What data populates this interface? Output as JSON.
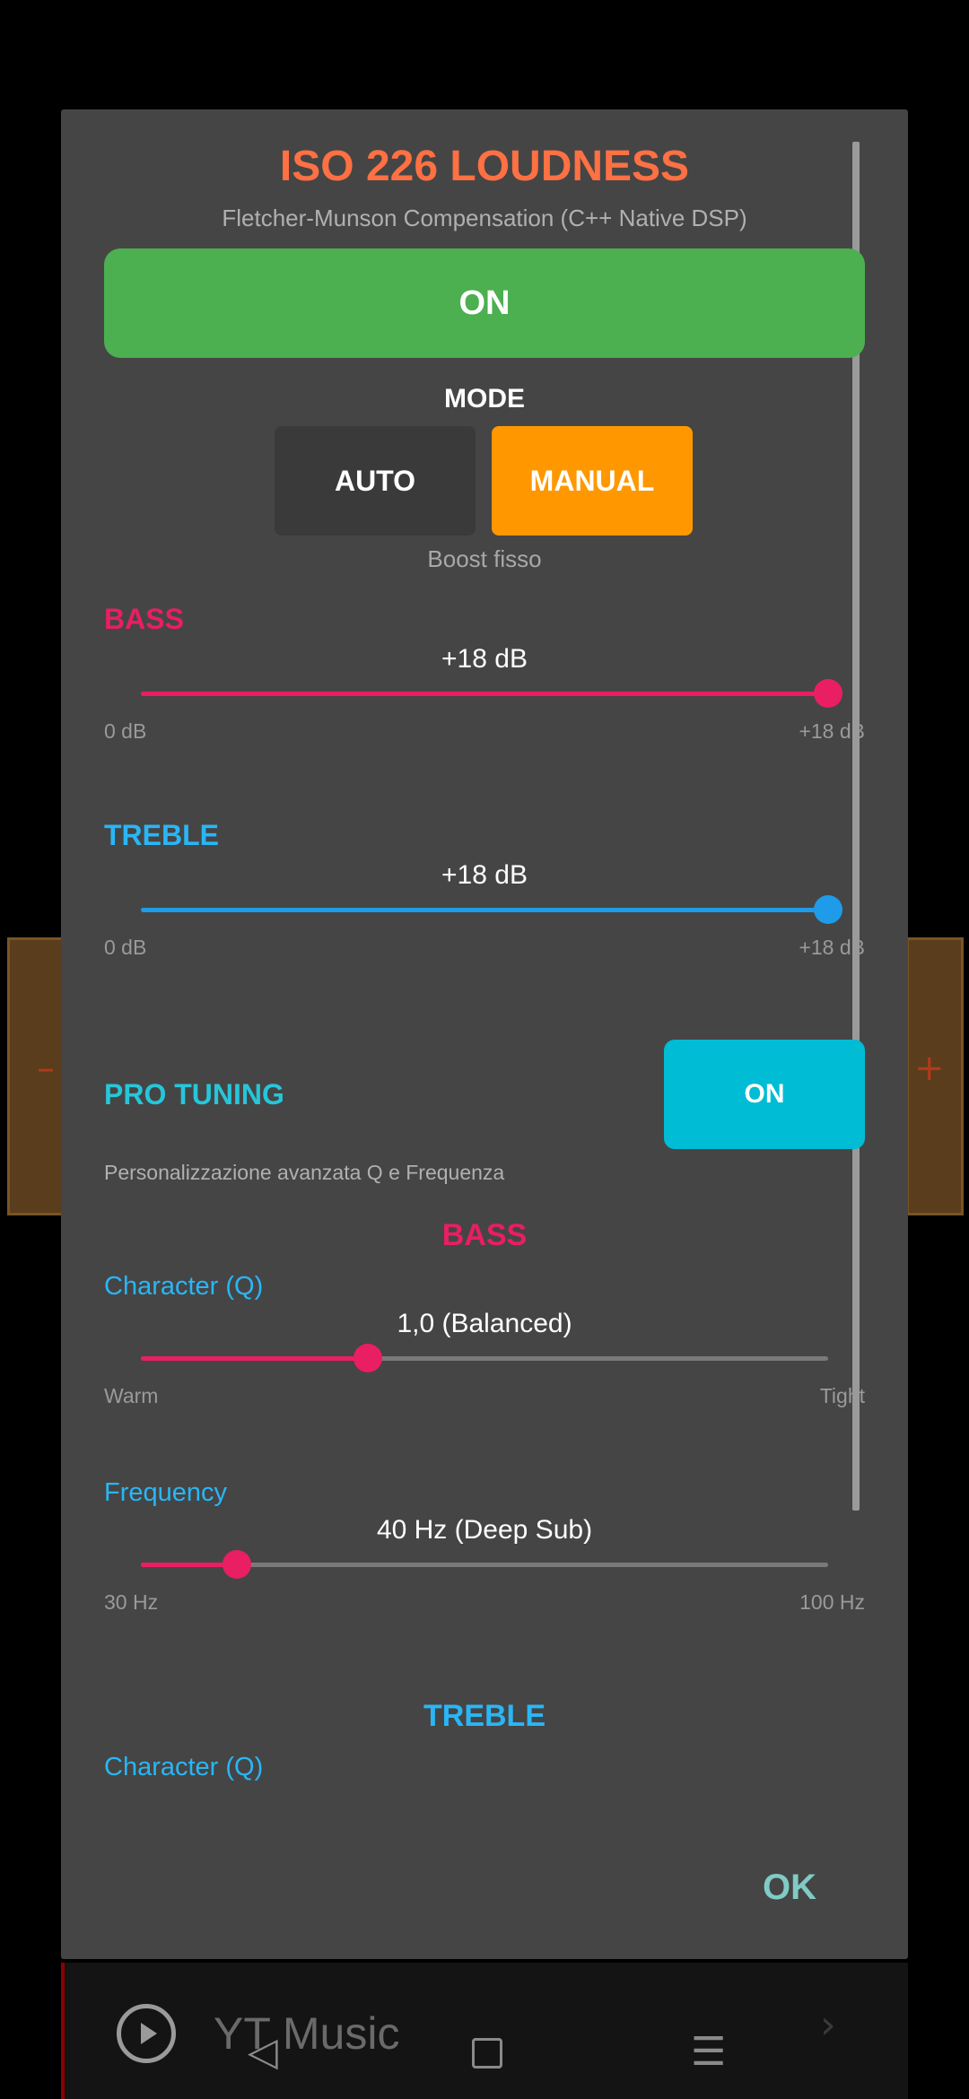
{
  "background": {
    "mini_player_title": "YT Music"
  },
  "dialog": {
    "title": "ISO 226 LOUDNESS",
    "subtitle": "Fletcher-Munson Compensation (C++ Native DSP)",
    "main_toggle": "ON",
    "mode": {
      "label": "MODE",
      "options": [
        "AUTO",
        "MANUAL"
      ],
      "selected": "MANUAL",
      "hint": "Boost fisso"
    },
    "bass": {
      "label": "BASS",
      "value": "+18 dB",
      "level": 1.0,
      "min_label": "0 dB",
      "max_label": "+18 dB"
    },
    "treble": {
      "label": "TREBLE",
      "value": "+18 dB",
      "level": 1.0,
      "min_label": "0 dB",
      "max_label": "+18 dB"
    },
    "pro_tuning": {
      "label": "PRO TUNING",
      "toggle": "ON",
      "description": "Personalizzazione avanzata Q e Frequenza",
      "bass": {
        "heading": "BASS",
        "character": {
          "label": "Character (Q)",
          "value": "1,0 (Balanced)",
          "level": 0.33,
          "min_label": "Warm",
          "max_label": "Tight"
        },
        "frequency": {
          "label": "Frequency",
          "value": "40 Hz (Deep Sub)",
          "level": 0.14,
          "min_label": "30 Hz",
          "max_label": "100 Hz"
        }
      },
      "treble": {
        "heading": "TREBLE",
        "character": {
          "label": "Character (Q)"
        }
      }
    },
    "ok_label": "OK"
  },
  "colors": {
    "title": "#ff7043",
    "bass": "#e91e63",
    "treble": "#1e9be9",
    "pro": "#00bcd4",
    "main_on": "#4caf50",
    "manual": "#ff9800"
  }
}
